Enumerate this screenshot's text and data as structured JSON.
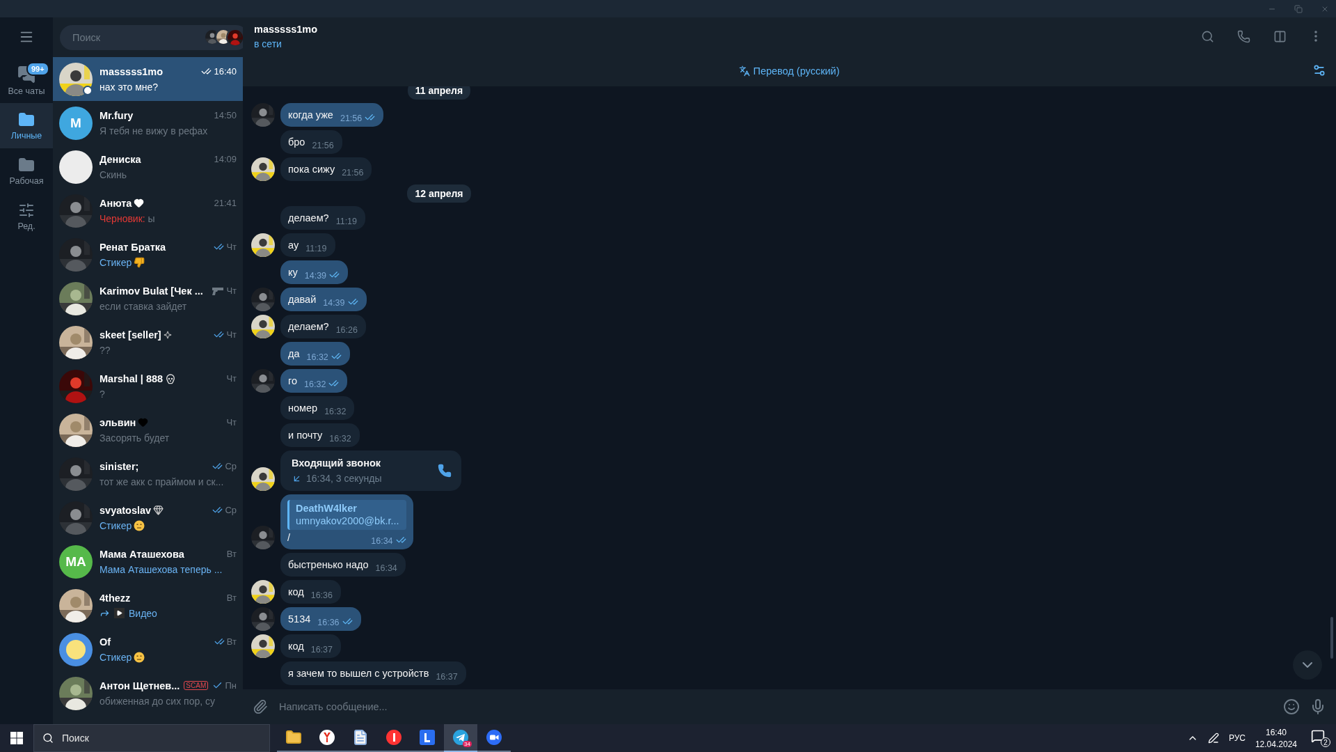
{
  "folders": [
    {
      "label": "Все чаты",
      "badge": "99+",
      "kind": "chats",
      "selected": false
    },
    {
      "label": "Личные",
      "kind": "folder",
      "selected": true
    },
    {
      "label": "Рабочая",
      "kind": "folder",
      "selected": false
    },
    {
      "label": "Ред.",
      "kind": "edit",
      "selected": false
    }
  ],
  "search": {
    "placeholder": "Поиск"
  },
  "chats": [
    {
      "name": "masssss1mo",
      "time": "16:40",
      "read": true,
      "kind": "text",
      "preview": "нах это мне?",
      "selected": true,
      "online": true
    },
    {
      "name": "Mr.fury",
      "time": "14:50",
      "kind": "text",
      "preview": "Я тебя не вижу в рефах",
      "selected": false,
      "avatar": {
        "kind": "initials",
        "initials": "M",
        "color": "#3fa7df"
      }
    },
    {
      "name": "Дениска",
      "time": "14:09",
      "kind": "text",
      "preview": "Скинь",
      "selected": false,
      "avatar": {
        "kind": "blank"
      }
    },
    {
      "name": "Анюта",
      "badge": {
        "kind": "white-heart"
      },
      "time": "21:41",
      "kind": "draft",
      "draft_label": "Черновик:",
      "preview": "ы",
      "selected": false
    },
    {
      "name": "Ренат Братка",
      "time": "Чт",
      "read": true,
      "kind": "media",
      "preview": "Стикер",
      "sticker": {
        "kind": "thumbs-down"
      },
      "selected": false
    },
    {
      "name": "Karimov Bulat [Чек ...",
      "emoji": {
        "kind": "gun"
      },
      "time": "Чт",
      "kind": "text",
      "preview": "если ставка зайдет",
      "selected": false
    },
    {
      "name": "skeet [seller]",
      "badge": {
        "kind": "sparkle"
      },
      "time": "Чт",
      "read": true,
      "kind": "text",
      "preview": "??",
      "selected": false
    },
    {
      "name": "Marshal | 888",
      "badge": {
        "kind": "skull"
      },
      "time": "Чт",
      "kind": "text",
      "preview": "?",
      "selected": false
    },
    {
      "name": "эльвин",
      "badge": {
        "kind": "black-heart"
      },
      "time": "Чт",
      "kind": "text",
      "preview": "Засорять будет",
      "selected": false
    },
    {
      "name": "sinister;",
      "time": "Ср",
      "read": true,
      "kind": "text",
      "preview": "тот же акк с праймом и ск...",
      "selected": false
    },
    {
      "name": "svyatoslav",
      "badge": {
        "kind": "gem"
      },
      "time": "Ср",
      "read": true,
      "kind": "media",
      "preview": "Стикер",
      "sticker": {
        "kind": "face"
      },
      "selected": false
    },
    {
      "name": "Мама Аташехова",
      "time": "Вт",
      "kind": "media",
      "preview": "Мама Аташехова теперь ...",
      "selected": false,
      "avatar": {
        "kind": "initials",
        "initials": "MA",
        "color": "#56b94a"
      }
    },
    {
      "name": "4thezz",
      "time": "Вт",
      "kind": "media",
      "forwarded": true,
      "attachment": {
        "kind": "video"
      },
      "preview": "Видео",
      "selected": false
    },
    {
      "name": "Of",
      "time": "Вт",
      "read": true,
      "kind": "media",
      "preview": "Стикер",
      "sticker": {
        "kind": "face"
      },
      "selected": false,
      "avatar": {
        "kind": "emoji"
      }
    },
    {
      "name": "Антон Щетнев...",
      "tag": "SCAM",
      "time": "Пн",
      "read": false,
      "kind": "text",
      "preview": "обиженная до сих пор, су",
      "selected": false
    }
  ],
  "header": {
    "title": "masssss1mo",
    "status": "в сети"
  },
  "translate_bar": {
    "label": "Перевод (русский)"
  },
  "messages": [
    {
      "kind": "date",
      "text": "11 апреля"
    },
    {
      "kind": "text",
      "outgoing": true,
      "text": "когда уже",
      "time": "21:56",
      "read": true,
      "avatar": true
    },
    {
      "kind": "text",
      "outgoing": false,
      "text": "бро",
      "time": "21:56",
      "avatar": false
    },
    {
      "kind": "text",
      "outgoing": false,
      "text": "пока сижу",
      "time": "21:56",
      "avatar": true
    },
    {
      "kind": "date",
      "text": "12 апреля"
    },
    {
      "kind": "text",
      "outgoing": false,
      "text": "делаем?",
      "time": "11:19",
      "avatar": false
    },
    {
      "kind": "text",
      "outgoing": false,
      "text": "ау",
      "time": "11:19",
      "avatar": true
    },
    {
      "kind": "text",
      "outgoing": true,
      "text": "ку",
      "time": "14:39",
      "read": true,
      "avatar": false
    },
    {
      "kind": "text",
      "outgoing": true,
      "text": "давай",
      "time": "14:39",
      "read": true,
      "avatar": true
    },
    {
      "kind": "text",
      "outgoing": false,
      "text": "делаем?",
      "time": "16:26",
      "avatar": true
    },
    {
      "kind": "text",
      "outgoing": true,
      "text": "да",
      "time": "16:32",
      "read": true,
      "avatar": false
    },
    {
      "kind": "text",
      "outgoing": true,
      "text": "го",
      "time": "16:32",
      "read": true,
      "avatar": true
    },
    {
      "kind": "text",
      "outgoing": false,
      "text": "номер",
      "time": "16:32",
      "avatar": false
    },
    {
      "kind": "text",
      "outgoing": false,
      "text": "и почту",
      "time": "16:32",
      "avatar": false
    },
    {
      "kind": "call",
      "outgoing": false,
      "title": "Входящий звонок",
      "detail": "16:34, 3 секунды",
      "avatar": true
    },
    {
      "kind": "contact",
      "outgoing": true,
      "contact_name": "DeathW4lker",
      "contact_detail": "umnyakov2000@bk.r...",
      "text": "/",
      "time": "16:34",
      "read": true,
      "avatar": true
    },
    {
      "kind": "text",
      "outgoing": false,
      "text": "быстренько надо",
      "time": "16:34",
      "avatar": false
    },
    {
      "kind": "text",
      "outgoing": false,
      "text": "код",
      "time": "16:36",
      "avatar": true
    },
    {
      "kind": "text",
      "outgoing": true,
      "text": "5134",
      "time": "16:36",
      "read": true,
      "avatar": true
    },
    {
      "kind": "text",
      "outgoing": false,
      "text": "код",
      "time": "16:37",
      "avatar": true
    },
    {
      "kind": "text",
      "outgoing": false,
      "text": "я зачем то вышел с устройств",
      "time": "16:37",
      "avatar": false
    }
  ],
  "composer": {
    "placeholder": "Написать сообщение..."
  },
  "taskbar": {
    "search_placeholder": "Поиск",
    "apps": [
      {
        "kind": "files",
        "selected": false
      },
      {
        "kind": "browser",
        "selected": false
      },
      {
        "kind": "python",
        "selected": false
      },
      {
        "kind": "yandex",
        "selected": false
      },
      {
        "kind": "l-app",
        "selected": false
      },
      {
        "kind": "telegram",
        "badge": "34",
        "selected": true
      },
      {
        "kind": "zoom",
        "selected": false
      }
    ],
    "language": "РУС",
    "time": "16:40",
    "date": "12.04.2024",
    "notifications": "2"
  }
}
